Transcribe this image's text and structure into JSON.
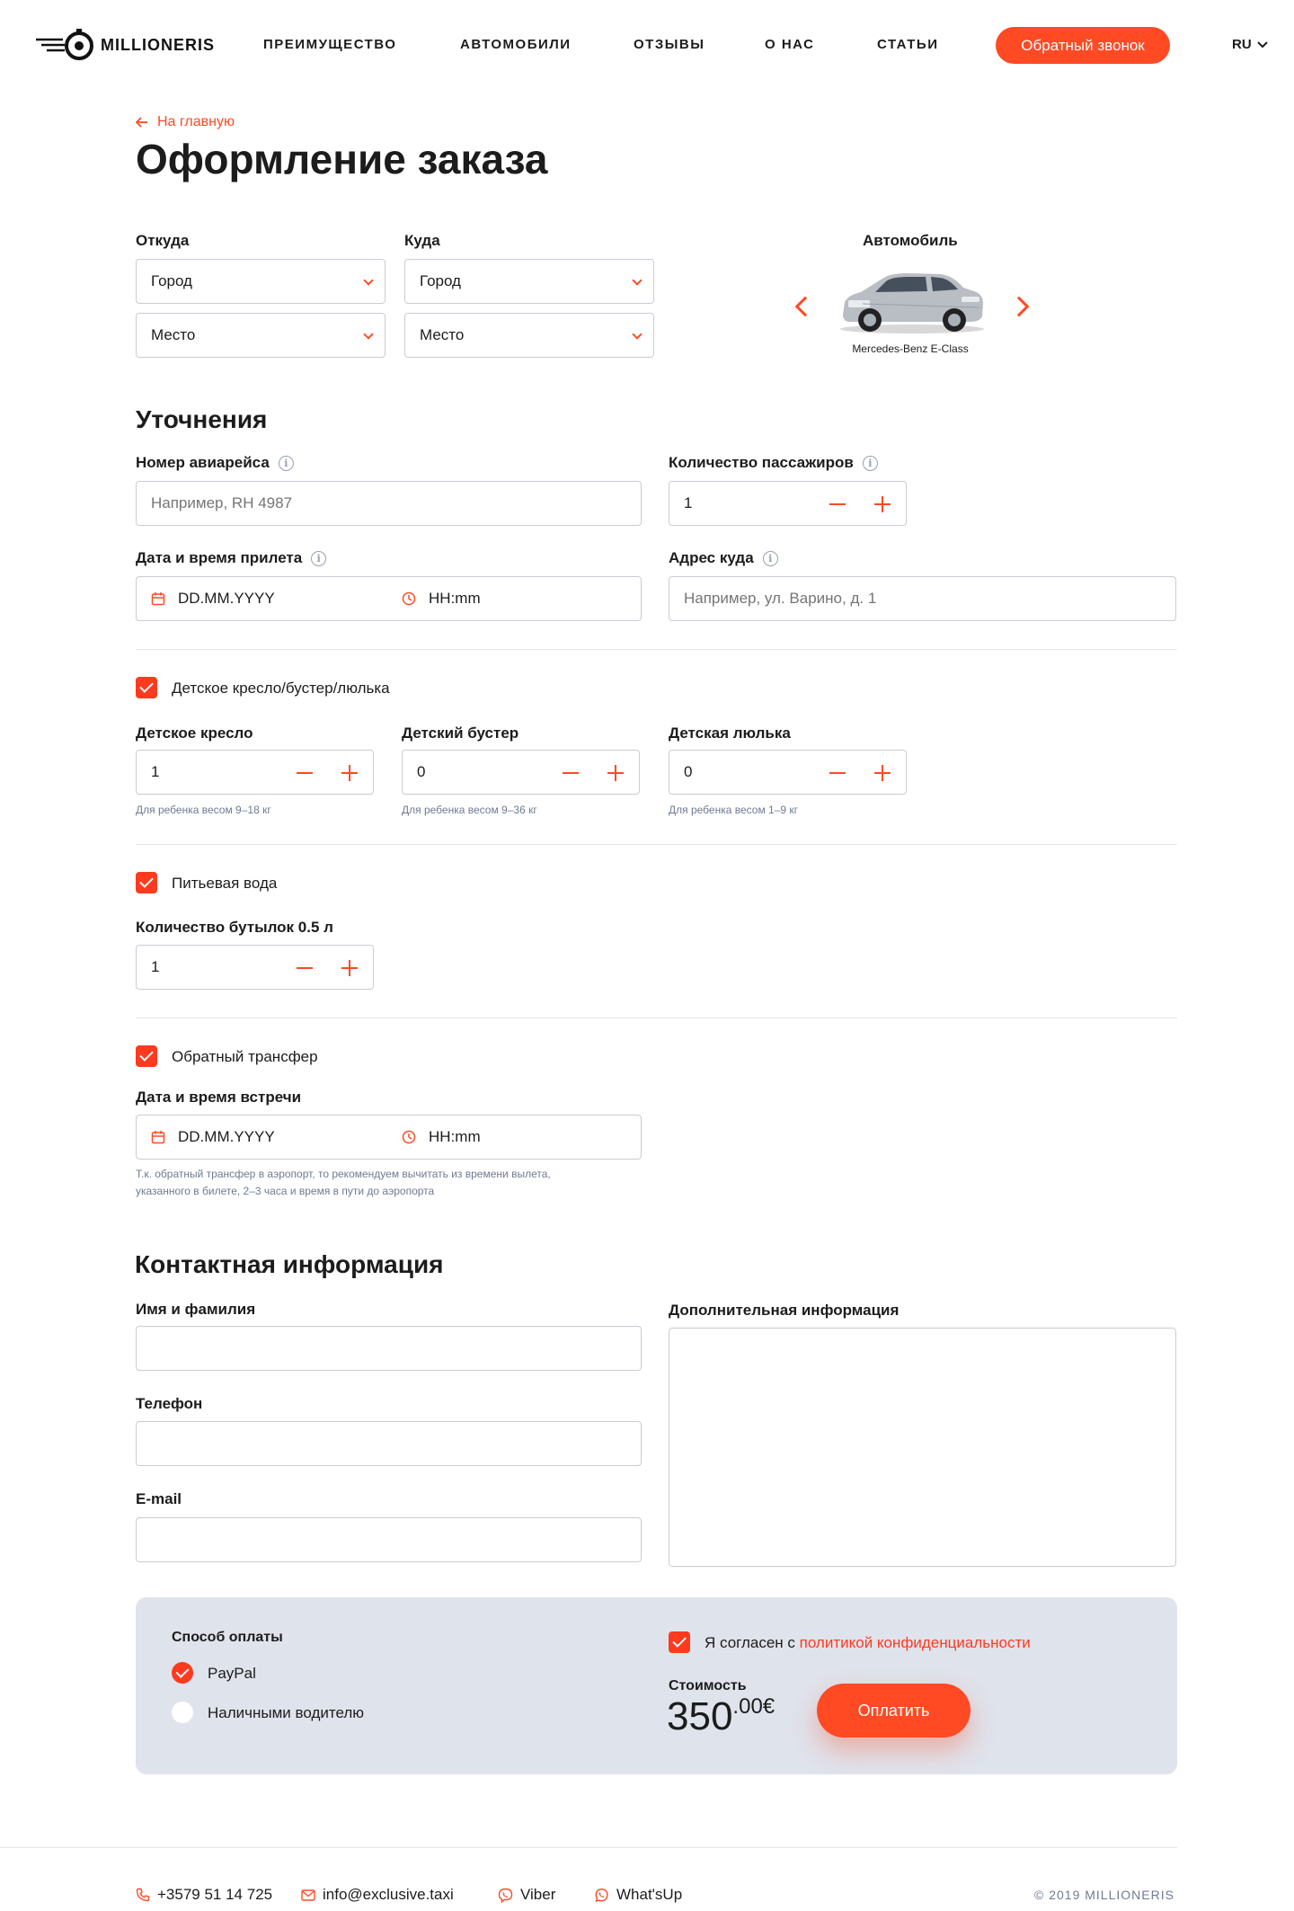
{
  "header": {
    "logo_text": "MILLIONERIS",
    "nav": [
      "ПРЕИМУЩЕСТВО",
      "АВТОМОБИЛИ",
      "ОТЗЫВЫ",
      "О НАС",
      "СТАТЬИ"
    ],
    "callback_label": "Обратный звонок",
    "lang": "RU"
  },
  "breadcrumb": {
    "back_label": "На главную"
  },
  "page_title": "Оформление заказа",
  "route": {
    "from_label": "Откуда",
    "to_label": "Куда",
    "from_city": "Город",
    "from_place": "Место",
    "to_city": "Город",
    "to_place": "Место"
  },
  "car": {
    "label": "Автомобиль",
    "model": "Mercedes-Benz E-Class"
  },
  "details": {
    "title": "Уточнения",
    "flight_label": "Номер авиарейса",
    "flight_placeholder": "Например, RH 4987",
    "passengers_label": "Количество пассажиров",
    "passengers_value": "1",
    "arrival_label": "Дата и время прилета",
    "date_placeholder": "DD.MM.YYYY",
    "time_placeholder": "HH:mm",
    "address_label": "Адрес куда",
    "address_placeholder": "Например, ул. Варино, д. 1"
  },
  "child_seats": {
    "checkbox_label": "Детское кресло/бустер/люлька",
    "items": [
      {
        "label": "Детское кресло",
        "value": "1",
        "hint": "Для ребенка весом 9–18 кг"
      },
      {
        "label": "Детский бустер",
        "value": "0",
        "hint": "Для ребенка весом 9–36 кг"
      },
      {
        "label": "Детская люлька",
        "value": "0",
        "hint": "Для ребенка весом 1–9 кг"
      }
    ]
  },
  "water": {
    "checkbox_label": "Питьевая вода",
    "bottles_label": "Количество бутылок 0.5 л",
    "bottles_value": "1"
  },
  "return_transfer": {
    "checkbox_label": "Обратный трансфер",
    "meeting_label": "Дата и время встречи",
    "date_placeholder": "DD.MM.YYYY",
    "time_placeholder": "HH:mm",
    "hint_line1": "Т.к. обратный трансфер в аэропорт, то рекомендуем вычитать из времени вылета,",
    "hint_line2": "указанного в билете, 2–3 часа и время в пути до аэропорта"
  },
  "contact": {
    "title": "Контактная информация",
    "name_label": "Имя и фамилия",
    "phone_label": "Телефон",
    "email_label": "E-mail",
    "extra_label": "Дополнительная информация"
  },
  "payment": {
    "method_label": "Способ оплаты",
    "options": [
      "PayPal",
      "Наличными водителю"
    ],
    "consent_prefix": "Я согласен с ",
    "consent_link": "политикой конфиденциальности",
    "cost_label": "Стоимость",
    "price_main": "350",
    "price_cents": ".00",
    "currency": "€",
    "pay_label": "Оплатить"
  },
  "footer": {
    "phone": "+3579 51 14 725",
    "email": "info@exclusive.taxi",
    "viber": "Viber",
    "whatsapp": "What'sUp",
    "copyright": "© 2019 MILLIONERIS"
  },
  "colors": {
    "accent": "#ff4a24",
    "payment_bg": "#dfe3ec",
    "border": "#c9ccd6",
    "hint": "#6f7a93"
  }
}
